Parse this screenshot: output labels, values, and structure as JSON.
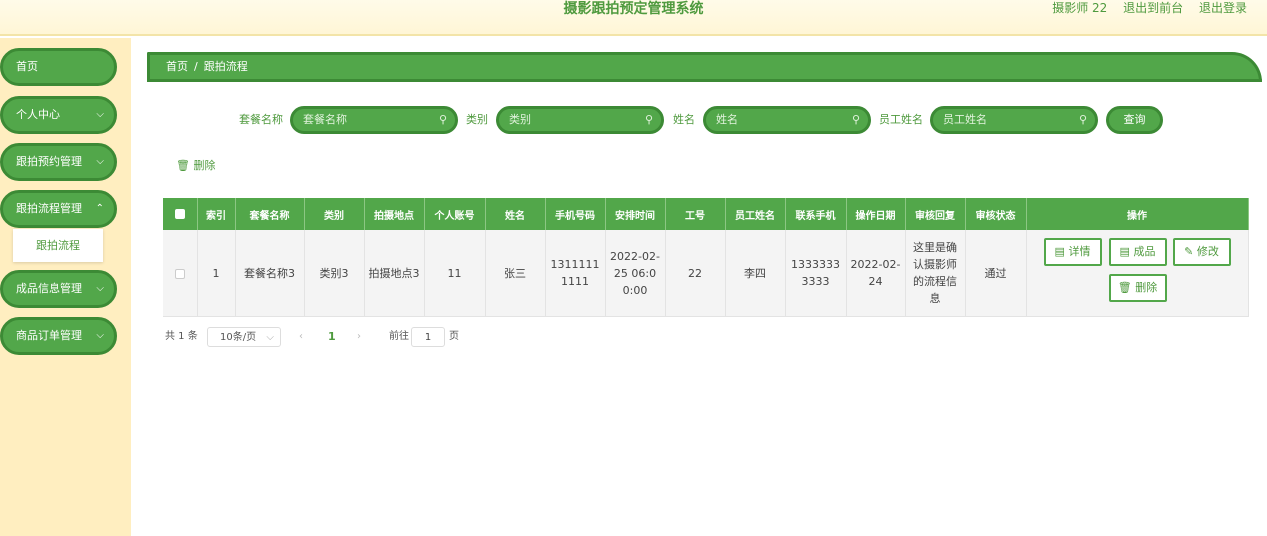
{
  "header": {
    "title": "摄影跟拍预定管理系统",
    "user_label": "摄影师 22",
    "frontend_link": "退出到前台",
    "logout_link": "退出登录"
  },
  "sidebar": {
    "items": [
      {
        "label": "首页"
      },
      {
        "label": "个人中心"
      },
      {
        "label": "跟拍预约管理"
      },
      {
        "label": "跟拍流程管理"
      },
      {
        "label": "成品信息管理"
      },
      {
        "label": "商品订单管理"
      }
    ],
    "submenu_label": "跟拍流程"
  },
  "breadcrumb": {
    "home": "首页",
    "separator": "/",
    "current": "跟拍流程"
  },
  "search": {
    "package_label": "套餐名称",
    "package_placeholder": "套餐名称",
    "category_label": "类别",
    "category_placeholder": "类别",
    "name_label": "姓名",
    "name_placeholder": "姓名",
    "staff_label": "员工姓名",
    "staff_placeholder": "员工姓名",
    "query_button": "查询"
  },
  "toolbar": {
    "delete_label": "删除"
  },
  "table": {
    "headers": [
      "索引",
      "套餐名称",
      "类别",
      "拍摄地点",
      "个人账号",
      "姓名",
      "手机号码",
      "安排时间",
      "工号",
      "员工姓名",
      "联系手机",
      "操作日期",
      "审核回复",
      "审核状态",
      "操作"
    ],
    "rows": [
      {
        "index": "1",
        "package": "套餐名称3",
        "category": "类别3",
        "location": "拍摄地点3",
        "account": "11",
        "name": "张三",
        "phone": "13111111111",
        "schedule": "2022-02-25 06:00:00",
        "staff_id": "22",
        "staff_name": "李四",
        "contact": "13333333333",
        "op_date": "2022-02-24",
        "reply": "这里是确认摄影师的流程信息",
        "status": "通过"
      }
    ],
    "actions": {
      "detail": "详情",
      "product": "成品",
      "edit": "修改",
      "delete": "删除"
    }
  },
  "pagination": {
    "total_text": "共 1 条",
    "page_size": "10条/页",
    "current_page": "1",
    "goto_label": "前往",
    "goto_value": "1",
    "page_unit": "页"
  },
  "colors": {
    "primary_green": "#52a74a",
    "border_green": "#3c8a35",
    "sidebar_bg": "#ffeec0"
  }
}
